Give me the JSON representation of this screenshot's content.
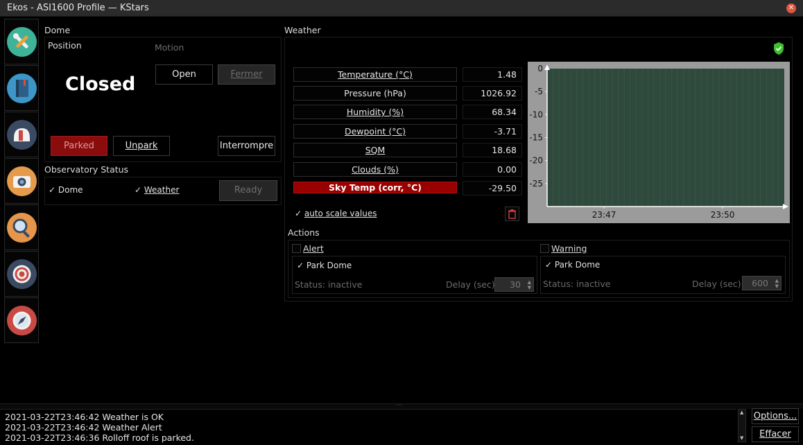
{
  "window": {
    "title": "Ekos - ASI1600 Profile — KStars"
  },
  "sidebar": {
    "items": [
      {
        "icon": "wrench-screwdriver-icon",
        "color": "#3eb39a"
      },
      {
        "icon": "notebook-icon",
        "color": "#3d96c7"
      },
      {
        "icon": "dome-icon",
        "color": "#3a4a62"
      },
      {
        "icon": "camera-icon",
        "color": "#e69a4b"
      },
      {
        "icon": "magnifier-icon",
        "color": "#e6964a"
      },
      {
        "icon": "target-icon",
        "color": "#3a4a62"
      },
      {
        "icon": "compass-icon",
        "color": "#c84a44"
      }
    ]
  },
  "dome": {
    "title": "Dome",
    "position_label": "Position",
    "motion_label": "Motion",
    "status": "Closed",
    "open_label": "Open",
    "close_label": "Fermer",
    "parked_label": "Parked",
    "unpark_label": "Unpark",
    "abort_label": "Interrompre"
  },
  "observatory": {
    "title": "Observatory Status",
    "dome_label": "Dome",
    "weather_label": "Weather",
    "ready_label": "Ready"
  },
  "weather": {
    "title": "Weather",
    "rows": [
      {
        "label": "Temperature (°C)",
        "value": "1.48"
      },
      {
        "label": "Pressure (hPa)",
        "value": "1026.92"
      },
      {
        "label": "Humidity (%)",
        "value": "68.34"
      },
      {
        "label": "Dewpoint (°C)",
        "value": "-3.71"
      },
      {
        "label": "SQM",
        "value": "18.68"
      },
      {
        "label": "Clouds (%)",
        "value": "0.00"
      },
      {
        "label": "Sky Temp (corr, °C)",
        "value": "-29.50"
      }
    ],
    "autoscale_label": "auto scale values"
  },
  "chart_data": {
    "type": "line",
    "y_ticks": [
      "0",
      "-5",
      "-10",
      "-15",
      "-20",
      "-25"
    ],
    "x_ticks": [
      "23:47",
      "23:50"
    ],
    "ylim": [
      -30,
      0
    ],
    "series": [],
    "colors": {
      "plot_bg": "#2f4a3d",
      "frame": "#8a8a8a"
    }
  },
  "actions": {
    "title": "Actions",
    "alert": {
      "label": "Alert",
      "park_label": "Park Dome",
      "status": "Status: inactive",
      "delay_label": "Delay (sec):",
      "delay_value": "30"
    },
    "warning": {
      "label": "Warning",
      "park_label": "Park Dome",
      "status": "Status: inactive",
      "delay_label": "Delay (sec):",
      "delay_value": "600"
    }
  },
  "log": {
    "lines": [
      "2021-03-22T23:46:42 Weather is OK",
      "2021-03-22T23:46:42 Weather Alert",
      "2021-03-22T23:46:36 Rolloff roof is parked."
    ],
    "options_label": "Options...",
    "clear_label": "Effacer"
  },
  "colors": {
    "accent_red": "#8b0c0c",
    "shield_green": "#3fbf2e"
  }
}
